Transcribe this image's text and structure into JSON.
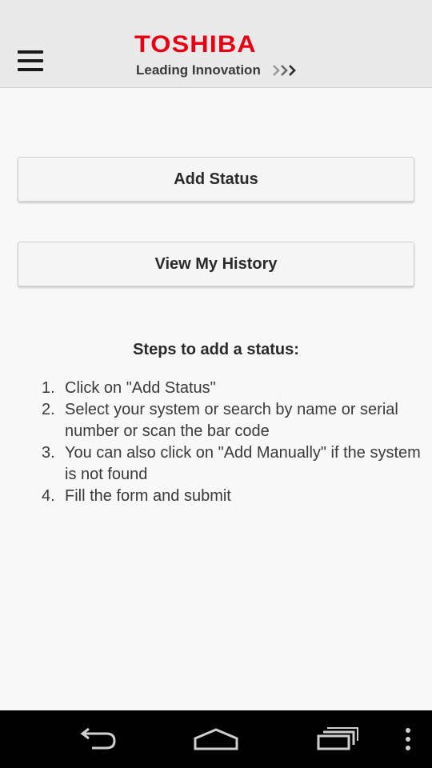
{
  "header": {
    "menu_icon": "hamburger-menu-icon",
    "logo_brand": "TOSHIBA",
    "logo_tagline": "Leading Innovation",
    "brand_color": "#e60012"
  },
  "main": {
    "add_status_label": "Add Status",
    "view_history_label": "View My History",
    "steps_title": "Steps to add a status:",
    "steps": [
      {
        "num": "1.",
        "text": "Click on \"Add Status\""
      },
      {
        "num": "2.",
        "text": "Select your system or search by name or serial number or scan the bar code"
      },
      {
        "num": "3.",
        "text": "You can also click on \"Add Manually\" if the system is not found"
      },
      {
        "num": "4.",
        "text": "Fill the form and submit"
      }
    ]
  },
  "navbar": {
    "back_icon": "back-icon",
    "home_icon": "home-icon",
    "recent_icon": "recent-apps-icon",
    "overflow_icon": "overflow-menu-icon"
  }
}
